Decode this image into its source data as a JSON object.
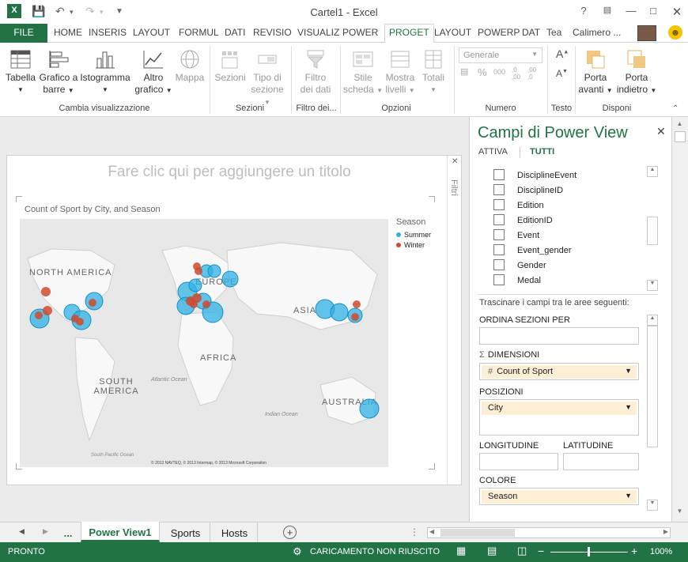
{
  "window": {
    "title": "Cartel1 - Excel",
    "user": "Calimero ..."
  },
  "tabs": [
    "FILE",
    "HOME",
    "INSERIS",
    "LAYOUT",
    "FORMUL",
    "DATI",
    "REVISIO",
    "VISUALIZ",
    "POWER",
    "PROGET",
    "LAYOUT",
    "POWERP",
    "DAT",
    "Tea"
  ],
  "ribbon": {
    "tabella": "Tabella",
    "grafico_barre_1": "Grafico a",
    "grafico_barre_2": "barre",
    "istogramma": "Istogramma",
    "altro_1": "Altro",
    "altro_2": "grafico",
    "mappa": "Mappa",
    "group_cambia": "Cambia visualizzazione",
    "sezioni": "Sezioni",
    "tipo_sezione_1": "Tipo di",
    "tipo_sezione_2": "sezione",
    "group_sezioni": "Sezioni",
    "filtro_1": "Filtro",
    "filtro_2": "dei dati",
    "group_filtro": "Filtro dei...",
    "stile_1": "Stile",
    "stile_2": "scheda",
    "mostra_1": "Mostra",
    "mostra_2": "livelli",
    "totali": "Totali",
    "group_opzioni": "Opzioni",
    "numero_format": "Generale",
    "group_numero": "Numero",
    "group_testo": "Testo",
    "porta_avanti_1": "Porta",
    "porta_avanti_2": "avanti",
    "porta_indietro_1": "Porta",
    "porta_indietro_2": "indietro",
    "group_disponi": "Disponi"
  },
  "canvas": {
    "title_placeholder": "Fare clic qui per aggiungere un titolo",
    "filters_label": "Filtri",
    "chart_title": "Count of Sport by City, and Season",
    "legend_title": "Season",
    "legend": [
      {
        "label": "Summer",
        "color": "#2fb2e6"
      },
      {
        "label": "Winter",
        "color": "#cf4a2e"
      }
    ],
    "map_labels": {
      "north_america": "NORTH AMERICA",
      "south_america": "SOUTH AMERICA",
      "europe": "EUROPE",
      "africa": "AFRICA",
      "asia": "ASIA",
      "australia": "AUSTRALIA",
      "atlantic": "Atlantic Ocean",
      "indian": "Indian Ocean",
      "pacific": "South Pacific Ocean"
    },
    "map_copyright": "© 2013 NAVTEQ, © 2013 Intermap, © 2013 Microsoft Corporation"
  },
  "pane": {
    "title": "Campi di Power View",
    "tab_active": "ATTIVA",
    "tab_all": "TUTTI",
    "fields": [
      "DisciplineEvent",
      "DisciplineID",
      "Edition",
      "EditionID",
      "Event",
      "Event_gender",
      "Gender",
      "Medal"
    ],
    "instructions": "Trascinare i campi tra le aree seguenti:",
    "ordina": "ORDINA SEZIONI PER",
    "dimensioni": "DIMENSIONI",
    "dimensioni_value": "Count of Sport",
    "posizioni": "POSIZIONI",
    "posizioni_value": "City",
    "longitudine": "LONGITUDINE",
    "latitudine": "LATITUDINE",
    "colore": "COLORE",
    "colore_value": "Season"
  },
  "sheets": {
    "ellipsis": "...",
    "items": [
      "Power View1",
      "Sports",
      "Hosts"
    ],
    "active": "Power View1"
  },
  "status": {
    "ready": "PRONTO",
    "load_error": "CARICAMENTO NON RIUSCITO",
    "zoom": "100%"
  }
}
